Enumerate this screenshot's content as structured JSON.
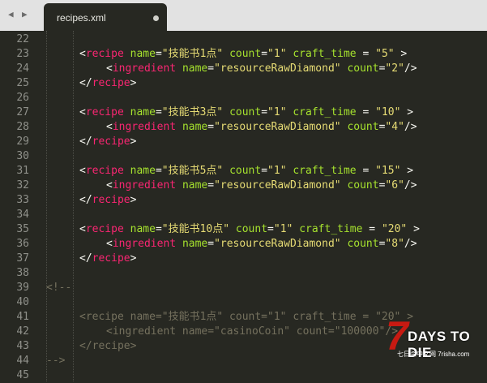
{
  "tabbar": {
    "nav_back": "◀",
    "nav_forward": "▶",
    "tab_title": "recipes.xml"
  },
  "lines": [
    {
      "n": "22",
      "indent": 0,
      "parts": []
    },
    {
      "n": "23",
      "indent": 2,
      "parts": [
        [
          "p",
          "<"
        ],
        [
          "t",
          "recipe"
        ],
        [
          "p",
          " "
        ],
        [
          "a",
          "name"
        ],
        [
          "p",
          "="
        ],
        [
          "s",
          "\"技能书1点\""
        ],
        [
          "p",
          " "
        ],
        [
          "a",
          "count"
        ],
        [
          "p",
          "="
        ],
        [
          "s",
          "\"1\""
        ],
        [
          "p",
          " "
        ],
        [
          "a",
          "craft_time"
        ],
        [
          "p",
          " = "
        ],
        [
          "s",
          "\"5\""
        ],
        [
          "p",
          " >"
        ]
      ]
    },
    {
      "n": "24",
      "indent": 3,
      "parts": [
        [
          "p",
          "<"
        ],
        [
          "t",
          "ingredient"
        ],
        [
          "p",
          " "
        ],
        [
          "a",
          "name"
        ],
        [
          "p",
          "="
        ],
        [
          "s",
          "\"resourceRawDiamond\""
        ],
        [
          "p",
          " "
        ],
        [
          "a",
          "count"
        ],
        [
          "p",
          "="
        ],
        [
          "s",
          "\"2\""
        ],
        [
          "p",
          "/>"
        ]
      ]
    },
    {
      "n": "25",
      "indent": 2,
      "parts": [
        [
          "p",
          "</"
        ],
        [
          "t",
          "recipe"
        ],
        [
          "p",
          ">"
        ]
      ]
    },
    {
      "n": "26",
      "indent": 0,
      "parts": []
    },
    {
      "n": "27",
      "indent": 2,
      "parts": [
        [
          "p",
          "<"
        ],
        [
          "t",
          "recipe"
        ],
        [
          "p",
          " "
        ],
        [
          "a",
          "name"
        ],
        [
          "p",
          "="
        ],
        [
          "s",
          "\"技能书3点\""
        ],
        [
          "p",
          " "
        ],
        [
          "a",
          "count"
        ],
        [
          "p",
          "="
        ],
        [
          "s",
          "\"1\""
        ],
        [
          "p",
          " "
        ],
        [
          "a",
          "craft_time"
        ],
        [
          "p",
          " = "
        ],
        [
          "s",
          "\"10\""
        ],
        [
          "p",
          " >"
        ]
      ]
    },
    {
      "n": "28",
      "indent": 3,
      "parts": [
        [
          "p",
          "<"
        ],
        [
          "t",
          "ingredient"
        ],
        [
          "p",
          " "
        ],
        [
          "a",
          "name"
        ],
        [
          "p",
          "="
        ],
        [
          "s",
          "\"resourceRawDiamond\""
        ],
        [
          "p",
          " "
        ],
        [
          "a",
          "count"
        ],
        [
          "p",
          "="
        ],
        [
          "s",
          "\"4\""
        ],
        [
          "p",
          "/>"
        ]
      ]
    },
    {
      "n": "29",
      "indent": 2,
      "parts": [
        [
          "p",
          "</"
        ],
        [
          "t",
          "recipe"
        ],
        [
          "p",
          ">"
        ]
      ]
    },
    {
      "n": "30",
      "indent": 0,
      "parts": []
    },
    {
      "n": "31",
      "indent": 2,
      "parts": [
        [
          "p",
          "<"
        ],
        [
          "t",
          "recipe"
        ],
        [
          "p",
          " "
        ],
        [
          "a",
          "name"
        ],
        [
          "p",
          "="
        ],
        [
          "s",
          "\"技能书5点\""
        ],
        [
          "p",
          " "
        ],
        [
          "a",
          "count"
        ],
        [
          "p",
          "="
        ],
        [
          "s",
          "\"1\""
        ],
        [
          "p",
          " "
        ],
        [
          "a",
          "craft_time"
        ],
        [
          "p",
          " = "
        ],
        [
          "s",
          "\"15\""
        ],
        [
          "p",
          " >"
        ]
      ]
    },
    {
      "n": "32",
      "indent": 3,
      "parts": [
        [
          "p",
          "<"
        ],
        [
          "t",
          "ingredient"
        ],
        [
          "p",
          " "
        ],
        [
          "a",
          "name"
        ],
        [
          "p",
          "="
        ],
        [
          "s",
          "\"resourceRawDiamond\""
        ],
        [
          "p",
          " "
        ],
        [
          "a",
          "count"
        ],
        [
          "p",
          "="
        ],
        [
          "s",
          "\"6\""
        ],
        [
          "p",
          "/>"
        ]
      ]
    },
    {
      "n": "33",
      "indent": 2,
      "parts": [
        [
          "p",
          "</"
        ],
        [
          "t",
          "recipe"
        ],
        [
          "p",
          ">"
        ]
      ]
    },
    {
      "n": "34",
      "indent": 0,
      "parts": []
    },
    {
      "n": "35",
      "indent": 2,
      "parts": [
        [
          "p",
          "<"
        ],
        [
          "t",
          "recipe"
        ],
        [
          "p",
          " "
        ],
        [
          "a",
          "name"
        ],
        [
          "p",
          "="
        ],
        [
          "s",
          "\"技能书10点\""
        ],
        [
          "p",
          " "
        ],
        [
          "a",
          "count"
        ],
        [
          "p",
          "="
        ],
        [
          "s",
          "\"1\""
        ],
        [
          "p",
          " "
        ],
        [
          "a",
          "craft_time"
        ],
        [
          "p",
          " = "
        ],
        [
          "s",
          "\"20\""
        ],
        [
          "p",
          " >"
        ]
      ]
    },
    {
      "n": "36",
      "indent": 3,
      "parts": [
        [
          "p",
          "<"
        ],
        [
          "t",
          "ingredient"
        ],
        [
          "p",
          " "
        ],
        [
          "a",
          "name"
        ],
        [
          "p",
          "="
        ],
        [
          "s",
          "\"resourceRawDiamond\""
        ],
        [
          "p",
          " "
        ],
        [
          "a",
          "count"
        ],
        [
          "p",
          "="
        ],
        [
          "s",
          "\"8\""
        ],
        [
          "p",
          "/>"
        ]
      ]
    },
    {
      "n": "37",
      "indent": 2,
      "parts": [
        [
          "p",
          "</"
        ],
        [
          "t",
          "recipe"
        ],
        [
          "p",
          ">"
        ]
      ]
    },
    {
      "n": "38",
      "indent": 0,
      "parts": []
    },
    {
      "n": "39",
      "indent": 0,
      "parts": [
        [
          "c",
          "<!--"
        ]
      ]
    },
    {
      "n": "40",
      "indent": 0,
      "parts": []
    },
    {
      "n": "41",
      "indent": 2,
      "parts": [
        [
          "cm",
          "<recipe name=\"技能书1点\" count=\"1\" craft_time = \"20\" >"
        ]
      ]
    },
    {
      "n": "42",
      "indent": 3,
      "parts": [
        [
          "cm",
          "<ingredient name=\"casinoCoin\" count=\"100000\"/>"
        ]
      ]
    },
    {
      "n": "43",
      "indent": 2,
      "parts": [
        [
          "cm",
          "</recipe>"
        ]
      ]
    },
    {
      "n": "44",
      "indent": 0,
      "parts": [
        [
          "c",
          "-->"
        ]
      ]
    },
    {
      "n": "45",
      "indent": 0,
      "parts": []
    }
  ],
  "watermark": {
    "seven": "7",
    "title": "DAYS TO DIE",
    "subtitle": "七日杀中文网 7risha.com"
  }
}
